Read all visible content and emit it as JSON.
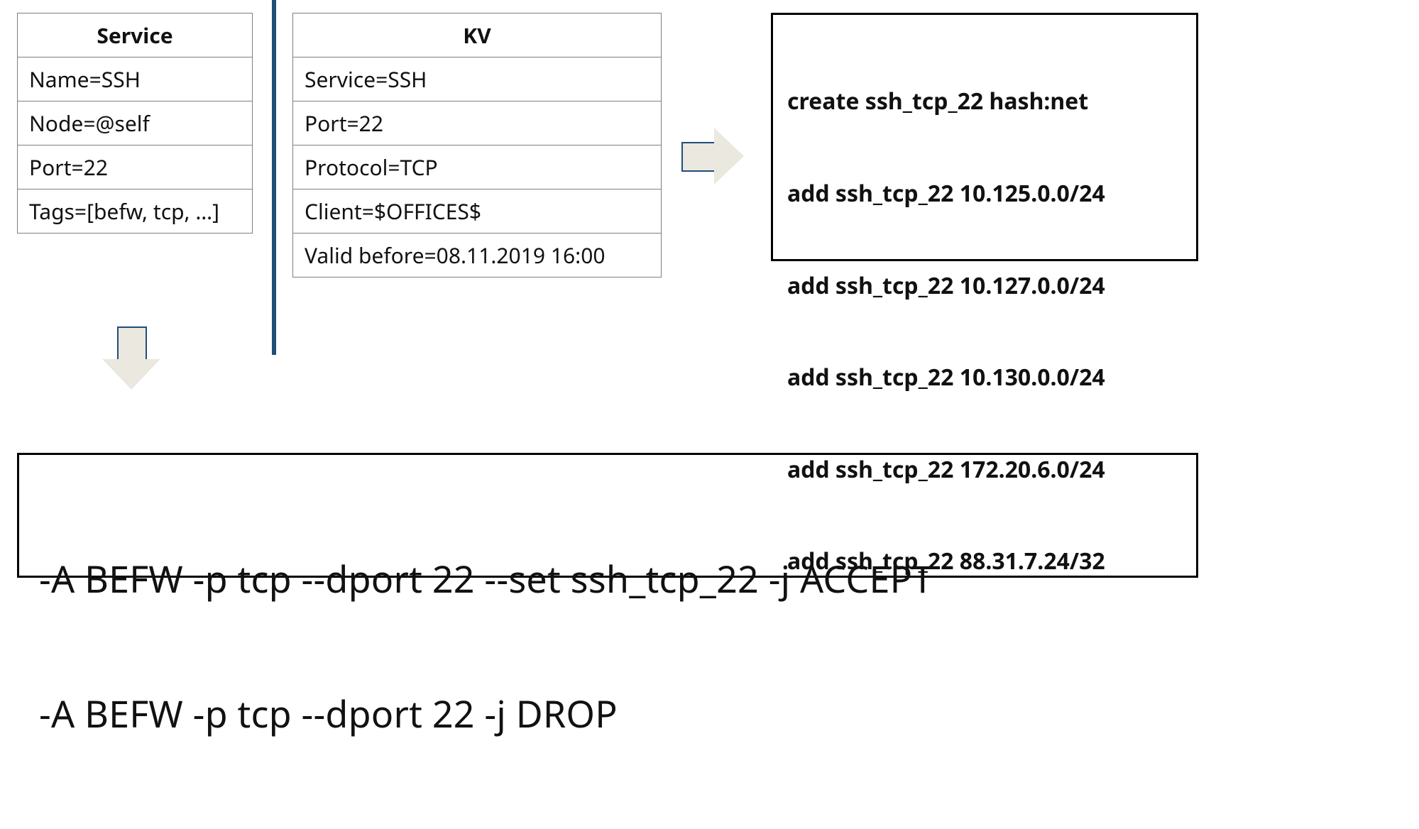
{
  "service_table": {
    "header": "Service",
    "rows": [
      "Name=SSH",
      "Node=@self",
      "Port=22",
      "Tags=[befw, tcp, …]"
    ]
  },
  "kv_table": {
    "header": "KV",
    "rows": [
      "Service=SSH",
      "Port=22",
      "Protocol=TCP",
      "Client=$OFFICES$",
      "Valid before=08.11.2019 16:00"
    ]
  },
  "ipset_output": {
    "lines": [
      "create ssh_tcp_22 hash:net",
      "add ssh_tcp_22 10.125.0.0/24",
      "add ssh_tcp_22 10.127.0.0/24",
      "add ssh_tcp_22 10.130.0.0/24",
      "add ssh_tcp_22 172.20.6.0/24",
      "add ssh_tcp_22 88.31.7.24/32"
    ]
  },
  "iptables_rules": {
    "lines": [
      "-A BEFW -p tcp --dport 22 --set ssh_tcp_22 -j ACCEPT",
      "-A BEFW -p tcp --dport 22 -j DROP"
    ]
  }
}
